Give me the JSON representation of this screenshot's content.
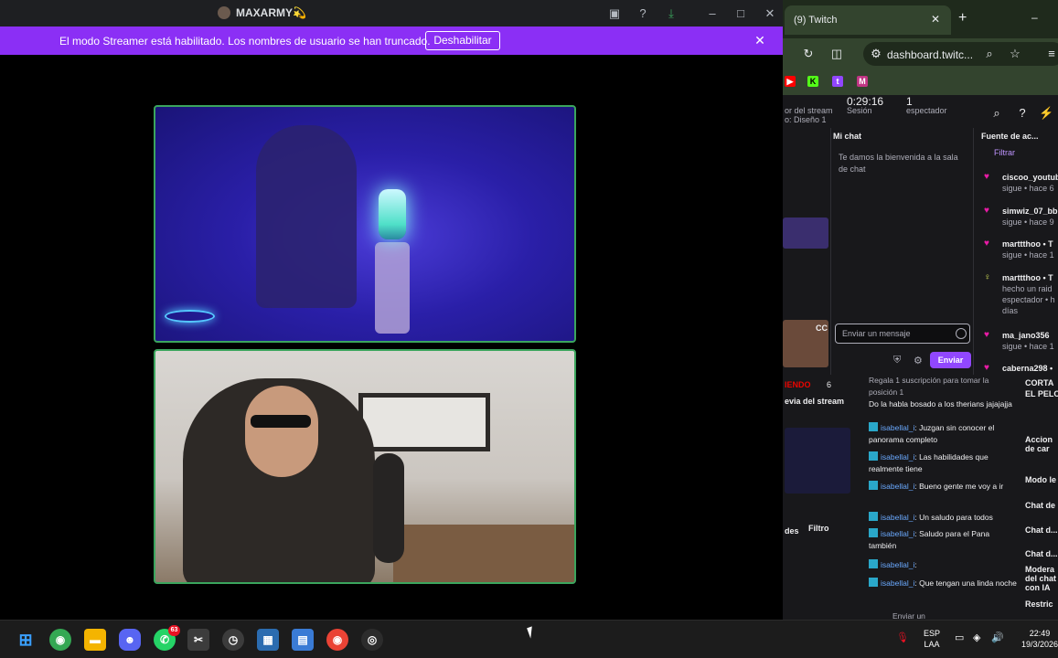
{
  "discord": {
    "window_title": "MAXARMY💫",
    "streamer_banner": {
      "message": "El modo Streamer está habilitado. Los nombres de usuario se han truncado.",
      "disable_label": "Deshabilitar"
    },
    "accent": "#8b2ff5",
    "speaking_border": "#3ba55d"
  },
  "chrome": {
    "tab_title": "(9) Twitch",
    "url": "dashboard.twitc...",
    "tab_close": "✕",
    "new_tab": "+"
  },
  "twitch": {
    "stream_time": "0:29:16",
    "stream_time_label": "Sesión",
    "viewers": "1",
    "viewers_label": "espectador",
    "left_cut_text": "or del stream",
    "left_cut_sub": "o: Diseño 1",
    "my_chat_title": "Mi chat",
    "welcome_message": "Te damos la bienvenida a la sala de chat",
    "chat_placeholder": "Enviar un mensaje",
    "send_label": "Enviar",
    "activity_title": "Fuente de ac...",
    "filter_label": "Filtrar",
    "activity": [
      {
        "name": "ciscoo_youtub",
        "sub": "sigue • hace 6"
      },
      {
        "name": "simwiz_07_bb",
        "sub": "sigue • hace 9"
      },
      {
        "name": "marttthoo • T",
        "sub": "sigue • hace 1"
      },
      {
        "name": "marttthoo • T",
        "sub": "hecho un raid",
        "sub2": "espectador • h",
        "sub3": "días"
      },
      {
        "name": "ma_jano356",
        "sub": "sigue • hace 1"
      },
      {
        "name": "caberna298 •",
        "sub": ""
      }
    ],
    "left_labels": {
      "cc": "CC",
      "endo": "IENDO",
      "six": "6",
      "preview": "evia del stream",
      "modes": "des",
      "filter": "Filtro"
    },
    "gift_text": "Regala 1 suscripción para tomar la posición 1",
    "lower_chat": [
      {
        "user": "",
        "text": "Do la habla bosado a los therians jajajajja"
      },
      {
        "user": "isabellal_i",
        "text": "Juzgan sin conocer el panorama completo"
      },
      {
        "user": "isabellal_i",
        "text": "Las habilidades que realmente tiene"
      },
      {
        "user": "isabellal_i",
        "text": "Bueno gente me voy a ir"
      },
      {
        "user": "isabellal_i",
        "text": "Un saludo para todos"
      },
      {
        "user": "isabellal_i",
        "text": "Saludo para el Pana también"
      },
      {
        "user": "isabellal_i",
        "text": ""
      },
      {
        "user": "isabellal_i",
        "text": "Que tengan una linda noche"
      }
    ],
    "lower_placeholder": "Enviar un",
    "right_col": [
      "CORTA",
      "EL PELO",
      "Accion",
      "de car",
      "Modo le",
      "Chat de",
      "Chat d...",
      "Chat d...",
      "Modera",
      "del chat",
      "con IA",
      "Restric"
    ]
  },
  "taskbar": {
    "apps": [
      "start",
      "chrome",
      "files",
      "discord",
      "whatsapp",
      "snipping",
      "clock",
      "calculator",
      "notepad",
      "chrome-2",
      "obs"
    ],
    "whatsapp_badge": "63",
    "language": "ESP",
    "language_sub": "LAA",
    "time": "22:49",
    "date": "19/3/2026"
  }
}
